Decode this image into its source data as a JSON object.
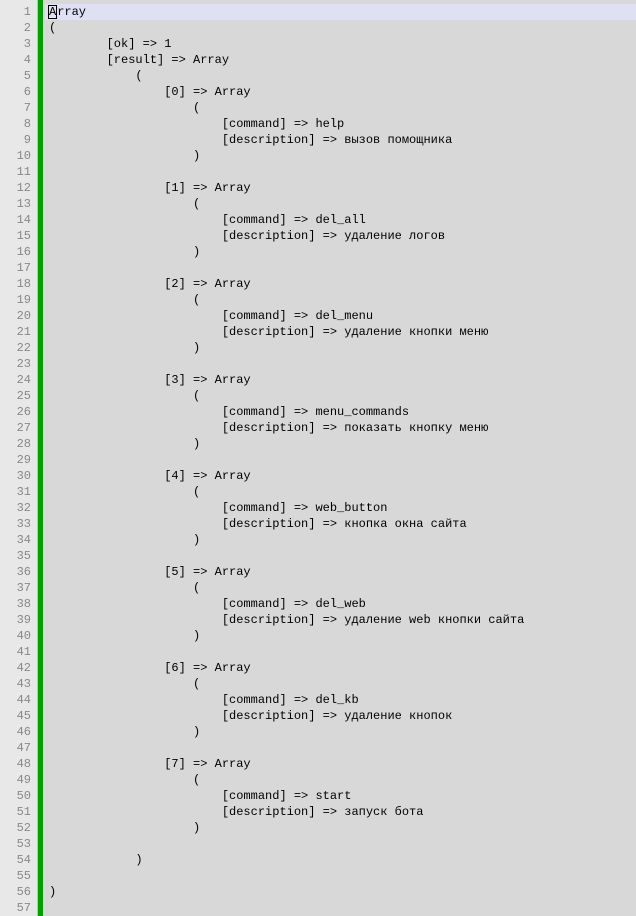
{
  "editor": {
    "total_lines": 57,
    "cursor_line": 1,
    "lines": [
      {
        "n": 1,
        "indent": 0,
        "text": "Array",
        "is_cursor": true,
        "cursor_char": "A",
        "rest": "rray"
      },
      {
        "n": 2,
        "indent": 0,
        "text": "("
      },
      {
        "n": 3,
        "indent": 1,
        "text": "[ok] => 1"
      },
      {
        "n": 4,
        "indent": 1,
        "text": "[result] => Array"
      },
      {
        "n": 5,
        "indent": 2,
        "text": "("
      },
      {
        "n": 6,
        "indent": 3,
        "text": "[0] => Array"
      },
      {
        "n": 7,
        "indent": 4,
        "text": "("
      },
      {
        "n": 8,
        "indent": 5,
        "text": "[command] => help"
      },
      {
        "n": 9,
        "indent": 5,
        "text": "[description] => вызов помощника"
      },
      {
        "n": 10,
        "indent": 4,
        "text": ")"
      },
      {
        "n": 11,
        "indent": 0,
        "text": ""
      },
      {
        "n": 12,
        "indent": 3,
        "text": "[1] => Array"
      },
      {
        "n": 13,
        "indent": 4,
        "text": "("
      },
      {
        "n": 14,
        "indent": 5,
        "text": "[command] => del_all"
      },
      {
        "n": 15,
        "indent": 5,
        "text": "[description] => удаление логов"
      },
      {
        "n": 16,
        "indent": 4,
        "text": ")"
      },
      {
        "n": 17,
        "indent": 0,
        "text": ""
      },
      {
        "n": 18,
        "indent": 3,
        "text": "[2] => Array"
      },
      {
        "n": 19,
        "indent": 4,
        "text": "("
      },
      {
        "n": 20,
        "indent": 5,
        "text": "[command] => del_menu"
      },
      {
        "n": 21,
        "indent": 5,
        "text": "[description] => удаление кнопки меню"
      },
      {
        "n": 22,
        "indent": 4,
        "text": ")"
      },
      {
        "n": 23,
        "indent": 0,
        "text": ""
      },
      {
        "n": 24,
        "indent": 3,
        "text": "[3] => Array"
      },
      {
        "n": 25,
        "indent": 4,
        "text": "("
      },
      {
        "n": 26,
        "indent": 5,
        "text": "[command] => menu_commands"
      },
      {
        "n": 27,
        "indent": 5,
        "text": "[description] => показать кнопку меню"
      },
      {
        "n": 28,
        "indent": 4,
        "text": ")"
      },
      {
        "n": 29,
        "indent": 0,
        "text": ""
      },
      {
        "n": 30,
        "indent": 3,
        "text": "[4] => Array"
      },
      {
        "n": 31,
        "indent": 4,
        "text": "("
      },
      {
        "n": 32,
        "indent": 5,
        "text": "[command] => web_button"
      },
      {
        "n": 33,
        "indent": 5,
        "text": "[description] => кнопка окна сайта"
      },
      {
        "n": 34,
        "indent": 4,
        "text": ")"
      },
      {
        "n": 35,
        "indent": 0,
        "text": ""
      },
      {
        "n": 36,
        "indent": 3,
        "text": "[5] => Array"
      },
      {
        "n": 37,
        "indent": 4,
        "text": "("
      },
      {
        "n": 38,
        "indent": 5,
        "text": "[command] => del_web"
      },
      {
        "n": 39,
        "indent": 5,
        "text": "[description] => удаление web кнопки сайта"
      },
      {
        "n": 40,
        "indent": 4,
        "text": ")"
      },
      {
        "n": 41,
        "indent": 0,
        "text": ""
      },
      {
        "n": 42,
        "indent": 3,
        "text": "[6] => Array"
      },
      {
        "n": 43,
        "indent": 4,
        "text": "("
      },
      {
        "n": 44,
        "indent": 5,
        "text": "[command] => del_kb"
      },
      {
        "n": 45,
        "indent": 5,
        "text": "[description] => удаление кнопок"
      },
      {
        "n": 46,
        "indent": 4,
        "text": ")"
      },
      {
        "n": 47,
        "indent": 0,
        "text": ""
      },
      {
        "n": 48,
        "indent": 3,
        "text": "[7] => Array"
      },
      {
        "n": 49,
        "indent": 4,
        "text": "("
      },
      {
        "n": 50,
        "indent": 5,
        "text": "[command] => start"
      },
      {
        "n": 51,
        "indent": 5,
        "text": "[description] => запуск бота"
      },
      {
        "n": 52,
        "indent": 4,
        "text": ")"
      },
      {
        "n": 53,
        "indent": 0,
        "text": ""
      },
      {
        "n": 54,
        "indent": 2,
        "text": ")"
      },
      {
        "n": 55,
        "indent": 0,
        "text": ""
      },
      {
        "n": 56,
        "indent": 0,
        "text": ")"
      },
      {
        "n": 57,
        "indent": 0,
        "text": ""
      }
    ],
    "indent_units": [
      0,
      8,
      12,
      16,
      20,
      24
    ]
  }
}
